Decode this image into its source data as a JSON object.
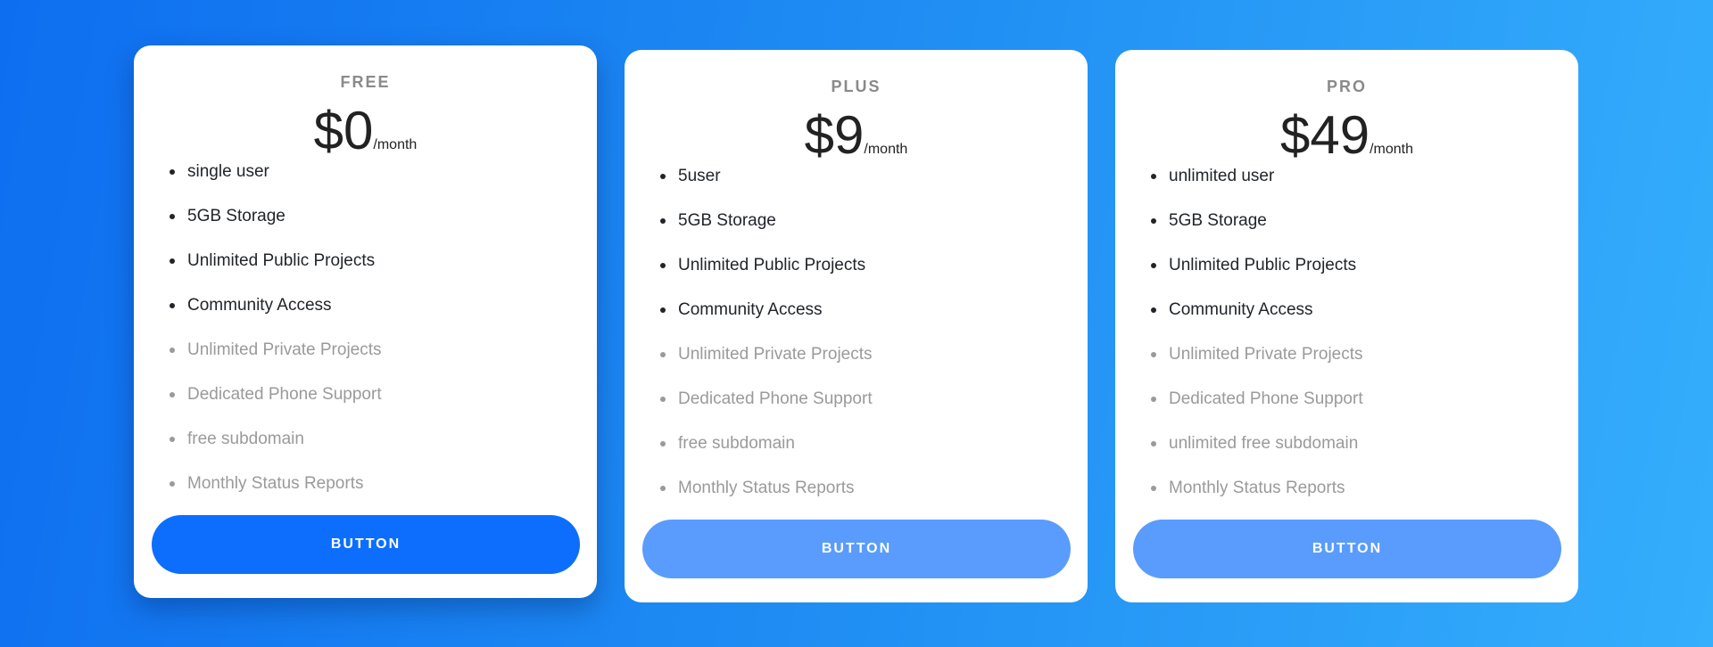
{
  "colors": {
    "accent": "#0d6efd",
    "accent_muted": "#5a9cfd",
    "feature_included": "#212529",
    "feature_excluded": "#9a9a9a"
  },
  "plans": [
    {
      "name": "FREE",
      "price": "$0",
      "period": "/month",
      "features": [
        {
          "label": "single user",
          "included": true
        },
        {
          "label": "5GB Storage",
          "included": true
        },
        {
          "label": "Unlimited Public Projects",
          "included": true
        },
        {
          "label": "Community Access",
          "included": true
        },
        {
          "label": "Unlimited Private Projects",
          "included": false
        },
        {
          "label": "Dedicated Phone Support",
          "included": false
        },
        {
          "label": "free subdomain",
          "included": false
        },
        {
          "label": "Monthly Status Reports",
          "included": false
        }
      ],
      "button_label": "BUTTON"
    },
    {
      "name": "PLUS",
      "price": "$9",
      "period": "/month",
      "features": [
        {
          "label": "5user",
          "included": true
        },
        {
          "label": "5GB Storage",
          "included": true
        },
        {
          "label": "Unlimited Public Projects",
          "included": true
        },
        {
          "label": "Community Access",
          "included": true
        },
        {
          "label": "Unlimited Private Projects",
          "included": false
        },
        {
          "label": "Dedicated Phone Support",
          "included": false
        },
        {
          "label": "free subdomain",
          "included": false
        },
        {
          "label": "Monthly Status Reports",
          "included": false
        }
      ],
      "button_label": "BUTTON"
    },
    {
      "name": "PRO",
      "price": "$49",
      "period": "/month",
      "features": [
        {
          "label": "unlimited user",
          "included": true
        },
        {
          "label": "5GB Storage",
          "included": true
        },
        {
          "label": "Unlimited Public Projects",
          "included": true
        },
        {
          "label": "Community Access",
          "included": true
        },
        {
          "label": "Unlimited Private Projects",
          "included": false
        },
        {
          "label": "Dedicated Phone Support",
          "included": false
        },
        {
          "label": "unlimited free subdomain",
          "included": false
        },
        {
          "label": "Monthly Status Reports",
          "included": false
        }
      ],
      "button_label": "BUTTON"
    }
  ]
}
